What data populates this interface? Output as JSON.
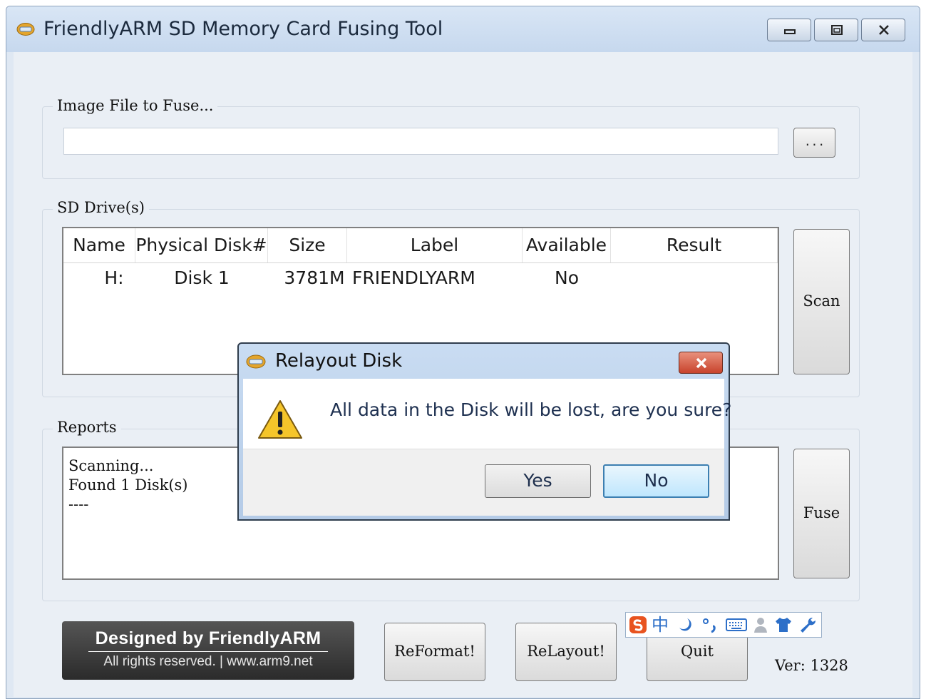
{
  "window": {
    "title": "FriendlyARM SD Memory Card Fusing Tool",
    "accent": "#c6d8ee"
  },
  "image_group": {
    "label": "Image File to Fuse...",
    "path_value": "",
    "browse_label": "..."
  },
  "sd_group": {
    "label": "SD Drive(s)",
    "columns": [
      "Name",
      "Physical Disk#",
      "Size",
      "Label",
      "Available",
      "Result"
    ],
    "rows": [
      {
        "name": "H:",
        "disk": "Disk 1",
        "size": "3781M",
        "label": "FRIENDLYARM",
        "available": "No",
        "result": ""
      }
    ],
    "scan_label": "Scan"
  },
  "reports_group": {
    "label": "Reports",
    "lines": [
      "Scanning...",
      "Found 1 Disk(s)",
      "----"
    ],
    "fuse_label": "Fuse"
  },
  "bottom": {
    "logo_title": "Designed by FriendlyARM",
    "logo_subtitle": "All rights reserved. | www.arm9.net",
    "reformat_label": "ReFormat!",
    "relayout_label": "ReLayout!",
    "quit_label": "Quit",
    "version": "Ver: 1328"
  },
  "ime_toolbar": {
    "icons": [
      "sogou-logo",
      "chinese-mode",
      "moon",
      "punctuation",
      "keyboard",
      "user",
      "shirt",
      "wrench"
    ],
    "mode_label": "中"
  },
  "dialog": {
    "title": "Relayout Disk",
    "message": "All data in the Disk will be lost, are you sure?",
    "yes_label": "Yes",
    "no_label": "No",
    "close_color": "#c8432c"
  }
}
